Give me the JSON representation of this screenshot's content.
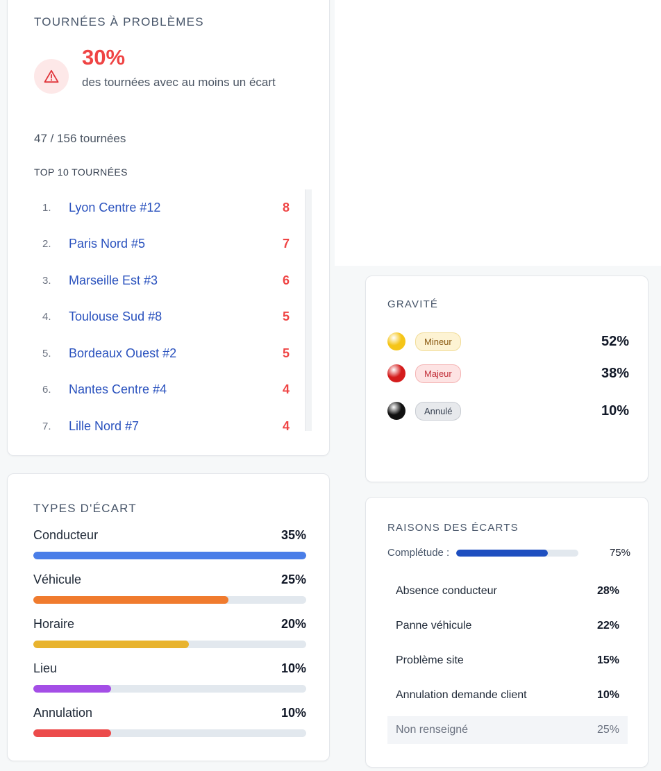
{
  "problems": {
    "title": "TOURNÉES À PROBLÈMES",
    "icon": "warning-triangle-icon",
    "percentage": "30%",
    "description": "des tournées avec au moins un écart",
    "count": "47 / 156 tournées",
    "top_title": "TOP 10 TOURNÉES",
    "top": [
      {
        "rank": "1.",
        "name": "Lyon Centre #12",
        "count": "8"
      },
      {
        "rank": "2.",
        "name": "Paris Nord #5",
        "count": "7"
      },
      {
        "rank": "3.",
        "name": "Marseille Est #3",
        "count": "6"
      },
      {
        "rank": "4.",
        "name": "Toulouse Sud #8",
        "count": "5"
      },
      {
        "rank": "5.",
        "name": "Bordeaux Ouest #2",
        "count": "5"
      },
      {
        "rank": "6.",
        "name": "Nantes Centre #4",
        "count": "4"
      },
      {
        "rank": "7.",
        "name": "Lille Nord #7",
        "count": "4"
      }
    ]
  },
  "types": {
    "title": "TYPES D'ÉCART",
    "items": [
      {
        "label": "Conducteur",
        "pct": "35%",
        "fill": 1.0,
        "color": "#4a7ee8"
      },
      {
        "label": "Véhicule",
        "pct": "25%",
        "fill": 0.714,
        "color": "#f07b2e"
      },
      {
        "label": "Horaire",
        "pct": "20%",
        "fill": 0.571,
        "color": "#e8b32e"
      },
      {
        "label": "Lieu",
        "pct": "10%",
        "fill": 0.286,
        "color": "#a44ee6"
      },
      {
        "label": "Annulation",
        "pct": "10%",
        "fill": 0.286,
        "color": "#ec4b4b"
      }
    ]
  },
  "gravity": {
    "title": "GRAVITÉ",
    "items": [
      {
        "label": "Mineur",
        "pct": "52%",
        "dot": "#f5c518",
        "pill_bg": "#fdf3d3",
        "pill_border": "#f1dc98",
        "pill_text": "#8a5a12"
      },
      {
        "label": "Majeur",
        "pct": "38%",
        "dot": "#d41c1c",
        "pill_bg": "#fde3e3",
        "pill_border": "#f4b4b4",
        "pill_text": "#c2303a"
      },
      {
        "label": "Annulé",
        "pct": "10%",
        "dot": "#111111",
        "pill_bg": "#e7e9ec",
        "pill_border": "#c8ccd2",
        "pill_text": "#374151"
      }
    ]
  },
  "reasons": {
    "title": "RAISONS DES ÉCARTS",
    "completeness_label": "Complétude :",
    "completeness_pct": "75%",
    "completeness_value": 0.75,
    "items": [
      {
        "label": "Absence conducteur",
        "pct": "28%"
      },
      {
        "label": "Panne véhicule",
        "pct": "22%"
      },
      {
        "label": "Problème site",
        "pct": "15%"
      },
      {
        "label": "Annulation demande client",
        "pct": "10%"
      }
    ],
    "unfilled": {
      "label": "Non renseigné",
      "pct": "25%"
    }
  }
}
